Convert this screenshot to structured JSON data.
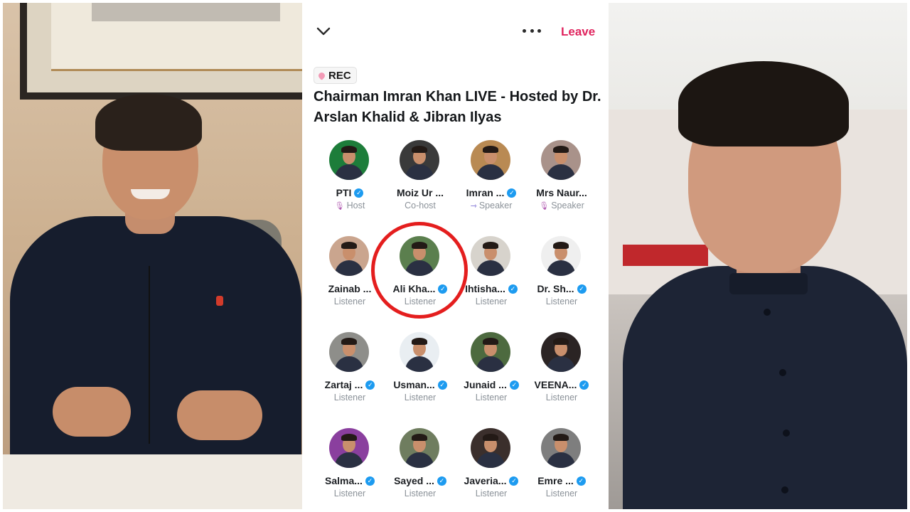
{
  "space": {
    "leave_label": "Leave",
    "rec_label": "REC",
    "title": "Chairman Imran Khan LIVE  - Hosted by Dr. Arslan Khalid & Jibran Ilyas"
  },
  "participants": [
    {
      "name": "PTI",
      "role": "Host",
      "verified": true,
      "role_icon": "microphone-icon",
      "avatar_color": "#1d7d3a"
    },
    {
      "name": "Moiz Ur ...",
      "role": "Co-host",
      "verified": false,
      "role_icon": "",
      "avatar_color": "#3a3a3a"
    },
    {
      "name": "Imran ...",
      "role": "Speaker",
      "verified": true,
      "role_icon": "speaker-icon",
      "avatar_color": "#b98a53"
    },
    {
      "name": "Mrs Naur...",
      "role": "Speaker",
      "verified": false,
      "role_icon": "microphone-icon",
      "avatar_color": "#a9928a"
    },
    {
      "name": "Zainab ...",
      "role": "Listener",
      "verified": false,
      "role_icon": "",
      "avatar_color": "#caa58e"
    },
    {
      "name": "Ali Kha...",
      "role": "Listener",
      "verified": true,
      "role_icon": "",
      "avatar_color": "#5b7f4e"
    },
    {
      "name": "Ihtisha...",
      "role": "Listener",
      "verified": true,
      "role_icon": "",
      "avatar_color": "#d7d3cc"
    },
    {
      "name": "Dr. Sh...",
      "role": "Listener",
      "verified": true,
      "role_icon": "",
      "avatar_color": "#efefef"
    },
    {
      "name": "Zartaj ...",
      "role": "Listener",
      "verified": true,
      "role_icon": "",
      "avatar_color": "#8e8e8a"
    },
    {
      "name": "Usman...",
      "role": "Listener",
      "verified": true,
      "role_icon": "",
      "avatar_color": "#e9eef2"
    },
    {
      "name": "Junaid ...",
      "role": "Listener",
      "verified": true,
      "role_icon": "",
      "avatar_color": "#4d6a3f"
    },
    {
      "name": "VEENA...",
      "role": "Listener",
      "verified": true,
      "role_icon": "",
      "avatar_color": "#2b2424"
    },
    {
      "name": "Salma...",
      "role": "Listener",
      "verified": true,
      "role_icon": "",
      "avatar_color": "#8a3f9e"
    },
    {
      "name": "Sayed ...",
      "role": "Listener",
      "verified": true,
      "role_icon": "",
      "avatar_color": "#6f7d5f"
    },
    {
      "name": "Javeria...",
      "role": "Listener",
      "verified": true,
      "role_icon": "",
      "avatar_color": "#3b2f2c"
    },
    {
      "name": "Emre ...",
      "role": "Listener",
      "verified": true,
      "role_icon": "",
      "avatar_color": "#7e7e7e"
    }
  ],
  "highlighted_participant": "Ali Kha...",
  "colors": {
    "leave": "#e0245e",
    "verified": "#1d9bf0",
    "highlight_ring": "#e41e1e",
    "rec_dot": "#f29ab6"
  }
}
